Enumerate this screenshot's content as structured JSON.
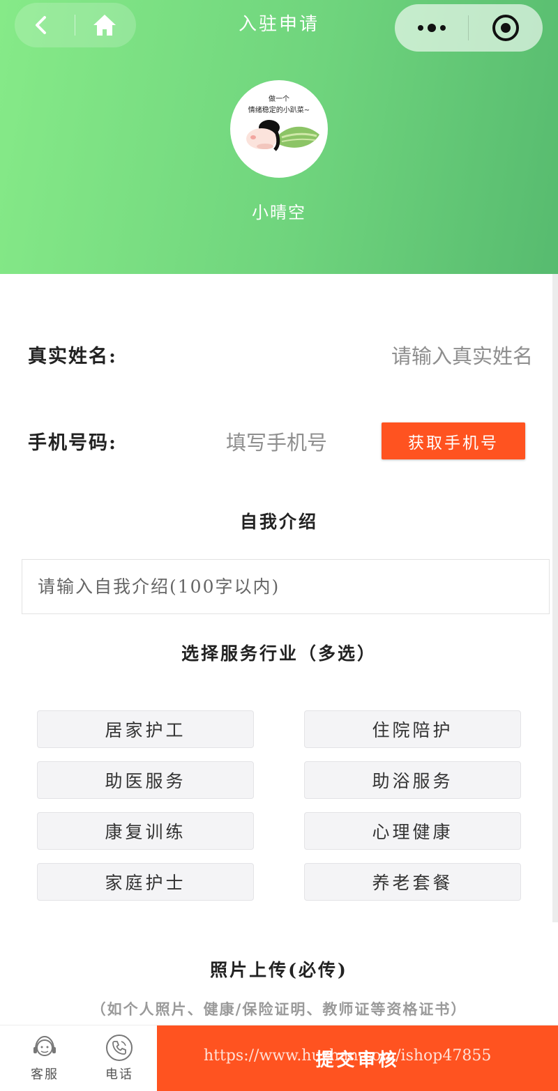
{
  "header": {
    "title": "入驻申请",
    "nickname": "小晴空",
    "avatar_caption": "做一个情绪稳定的小趴菜~",
    "nav": {
      "back_icon": "chevron-left-icon",
      "home_icon": "home-icon"
    },
    "capsule": {
      "more_icon": "more-dots-icon",
      "close_icon": "target-circle-icon"
    },
    "gradient_colors": [
      "#86ea88",
      "#57bb6f"
    ]
  },
  "form": {
    "name": {
      "label": "真实姓名:",
      "placeholder": "请输入真实姓名"
    },
    "phone": {
      "label": "手机号码:",
      "placeholder": "填写手机号",
      "button_label": "获取手机号"
    },
    "intro": {
      "title": "自我介绍",
      "placeholder": "请输入自我介绍(100字以内)"
    },
    "services": {
      "title": "选择服务行业（多选）",
      "items": [
        "居家护工",
        "住院陪护",
        "助医服务",
        "助浴服务",
        "康复训练",
        "心理健康",
        "家庭护士",
        "养老套餐"
      ]
    },
    "upload": {
      "title": "照片上传(必传)",
      "hint": "（如个人照片、健康/保险证明、教师证等资格证书）"
    }
  },
  "bottom_bar": {
    "tabs": [
      {
        "label": "客服",
        "icon": "customer-service-icon"
      },
      {
        "label": "电话",
        "icon": "phone-icon"
      }
    ],
    "submit_label": "提交审核",
    "watermark": "https://www.huzhan.com/ishop47855"
  },
  "colors": {
    "accent": "#ff5320",
    "green": "#6fd47d"
  }
}
